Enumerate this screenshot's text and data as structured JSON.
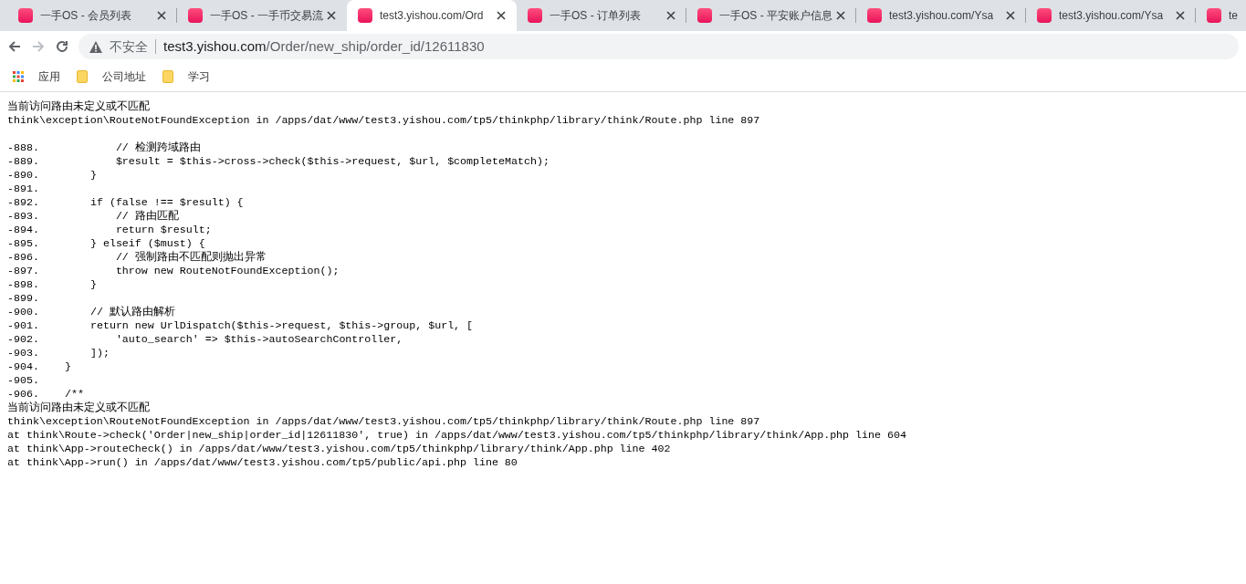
{
  "browser": {
    "tabs": [
      {
        "title": "一手OS - 会员列表",
        "selected": false
      },
      {
        "title": "一手OS - 一手币交易流",
        "selected": false
      },
      {
        "title": "test3.yishou.com/Ord",
        "selected": true
      },
      {
        "title": "一手OS - 订单列表",
        "selected": false
      },
      {
        "title": "一手OS - 平安账户信息",
        "selected": false
      },
      {
        "title": "test3.yishou.com/Ysa",
        "selected": false
      },
      {
        "title": "test3.yishou.com/Ysa",
        "selected": false
      },
      {
        "title": "te",
        "selected": false
      }
    ],
    "address": {
      "security_label": "不安全",
      "host": "test3.yishou.com",
      "path": "/Order/new_ship/order_id/12611830"
    },
    "bookmarks": [
      {
        "kind": "apps",
        "label": "应用"
      },
      {
        "kind": "folder",
        "label": "公司地址"
      },
      {
        "kind": "folder",
        "label": "学习"
      }
    ]
  },
  "page": {
    "header_lines": [
      {
        "kind": "message",
        "text": "当前访问路由未定义或不匹配"
      },
      {
        "kind": "trace",
        "text": "think\\exception\\RouteNotFoundException in /apps/dat/www/test3.yishou.com/tp5/thinkphp/library/think/Route.php line 897"
      }
    ],
    "code_lines": [
      {
        "number": "-888.",
        "code": "        // 检测跨域路由"
      },
      {
        "number": "-889.",
        "code": "        $result = $this->cross->check($this->request, $url, $completeMatch);"
      },
      {
        "number": "-890.",
        "code": "    }"
      },
      {
        "number": "-891."
      },
      {
        "number": "-892.",
        "code": "    if (false !== $result) {"
      },
      {
        "number": "-893.",
        "code": "        // 路由匹配"
      },
      {
        "number": "-894.",
        "code": "        return $result;"
      },
      {
        "number": "-895.",
        "code": "    } elseif ($must) {"
      },
      {
        "number": "-896.",
        "code": "        // 强制路由不匹配则抛出异常"
      },
      {
        "number": "-897.",
        "code": "        throw new RouteNotFoundException();"
      },
      {
        "number": "-898.",
        "code": "    }"
      },
      {
        "number": "-899."
      },
      {
        "number": "-900.",
        "code": "    // 默认路由解析"
      },
      {
        "number": "-901.",
        "code": "    return new UrlDispatch($this->request, $this->group, $url, ["
      },
      {
        "number": "-902.",
        "code": "        'auto_search' => $this->autoSearchController,"
      },
      {
        "number": "-903.",
        "code": "    ]);"
      },
      {
        "number": "-904.",
        "code": "}"
      },
      {
        "number": "-905."
      },
      {
        "number": "-906.",
        "code": "/**"
      }
    ],
    "footer_lines": [
      {
        "kind": "message",
        "text": "当前访问路由未定义或不匹配"
      },
      {
        "kind": "trace",
        "text": "think\\exception\\RouteNotFoundException in /apps/dat/www/test3.yishou.com/tp5/thinkphp/library/think/Route.php line 897"
      },
      {
        "kind": "trace",
        "text": "at think\\Route->check('Order|new_ship|order_id|12611830', true) in /apps/dat/www/test3.yishou.com/tp5/thinkphp/library/think/App.php line 604"
      },
      {
        "kind": "trace",
        "text": "at think\\App->routeCheck() in /apps/dat/www/test3.yishou.com/tp5/thinkphp/library/think/App.php line 402"
      },
      {
        "kind": "trace",
        "text": "at think\\App->run() in /apps/dat/www/test3.yishou.com/tp5/public/api.php line 80"
      }
    ]
  }
}
